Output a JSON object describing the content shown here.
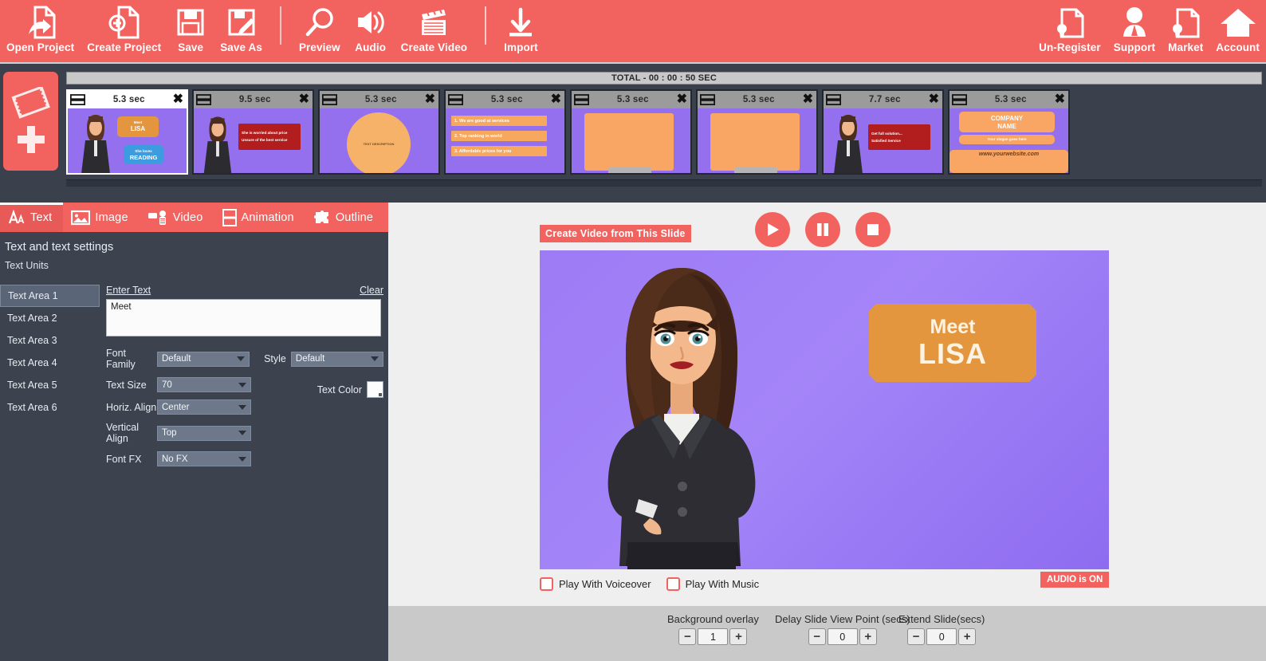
{
  "toolbar": {
    "left_items": [
      {
        "label": "Open Project",
        "icon": "open-project-icon"
      },
      {
        "label": "Create Project",
        "icon": "create-project-icon"
      },
      {
        "label": "Save",
        "icon": "save-icon"
      },
      {
        "label": "Save As",
        "icon": "save-as-icon"
      },
      {
        "label": "Preview",
        "icon": "preview-magnifier-icon"
      },
      {
        "label": "Audio",
        "icon": "audio-speaker-icon"
      },
      {
        "label": "Create Video",
        "icon": "create-video-clapper-icon"
      },
      {
        "label": "Import",
        "icon": "import-download-icon"
      }
    ],
    "right_items": [
      {
        "label": "Un-Register",
        "icon": "un-register-certificate-icon"
      },
      {
        "label": "Support",
        "icon": "support-person-icon"
      },
      {
        "label": "Market",
        "icon": "market-certificate-icon"
      },
      {
        "label": "Account",
        "icon": "account-home-icon"
      }
    ],
    "accent_color": "#f2635f"
  },
  "timeline": {
    "total_label": "TOTAL -  00 : 00 : 50 SEC",
    "add_slide_name": "add-slide-button",
    "slides": [
      {
        "duration": "5.3 sec",
        "active": true,
        "kind": "woman-meet-lisa",
        "texts": [
          "Meet",
          "LISA",
          "She loves",
          "READING"
        ]
      },
      {
        "duration": "9.5 sec",
        "active": false,
        "kind": "woman-red-box",
        "texts": [
          "She is worried about price",
          "Unsure of the best service"
        ]
      },
      {
        "duration": "5.3 sec",
        "active": false,
        "kind": "circle",
        "texts": [
          "TEXT DESCRIPTION"
        ]
      },
      {
        "duration": "5.3 sec",
        "active": false,
        "kind": "list",
        "texts": [
          "1. We are good at services",
          "2. Top ranking in world",
          "3. Affordable prices for you"
        ]
      },
      {
        "duration": "5.3 sec",
        "active": false,
        "kind": "orange-panel",
        "texts": []
      },
      {
        "duration": "5.3 sec",
        "active": false,
        "kind": "orange-panel",
        "texts": []
      },
      {
        "duration": "7.7 sec",
        "active": false,
        "kind": "woman-red-box",
        "texts": [
          "Get full solution...",
          "Satisfied Service"
        ]
      },
      {
        "duration": "5.3 sec",
        "active": false,
        "kind": "company",
        "texts": [
          "COMPANY",
          "NAME",
          "Your slogan goes here",
          "www.yourwebsite.com"
        ]
      }
    ]
  },
  "left_panel": {
    "tabs": [
      {
        "label": "Text",
        "icon": "text-aa-icon",
        "active": true
      },
      {
        "label": "Image",
        "icon": "image-picture-icon",
        "active": false
      },
      {
        "label": "Video",
        "icon": "video-camera-icon",
        "active": false
      },
      {
        "label": "Animation",
        "icon": "animation-frames-icon",
        "active": false
      },
      {
        "label": "Outline",
        "icon": "outline-puzzle-icon",
        "active": false
      }
    ],
    "title": "Text and text settings",
    "units_header": "Text Units",
    "units": [
      {
        "label": "Text Area 1",
        "selected": true
      },
      {
        "label": "Text Area 2",
        "selected": false
      },
      {
        "label": "Text Area 3",
        "selected": false
      },
      {
        "label": "Text Area 4",
        "selected": false
      },
      {
        "label": "Text Area 5",
        "selected": false
      },
      {
        "label": "Text Area 6",
        "selected": false
      }
    ],
    "enter_text_label": "Enter Text",
    "clear_label": "Clear",
    "text_value": "Meet",
    "fields": {
      "font_family_label": "Font Family",
      "font_family_value": "Default",
      "style_label": "Style",
      "style_value": "Default",
      "text_size_label": "Text Size",
      "text_size_value": "70",
      "horiz_align_label": "Horiz. Align",
      "horiz_align_value": "Center",
      "vertical_align_label": "Vertical Align",
      "vertical_align_value": "Top",
      "font_fx_label": "Font FX",
      "font_fx_value": "No FX",
      "text_color_label": "Text Color",
      "text_color_value": "#fdfdfd"
    }
  },
  "preview": {
    "create_video_button": "Create Video from This Slide",
    "play_name": "play-button",
    "pause_name": "pause-button",
    "stop_name": "stop-button",
    "slide": {
      "background_color": "#9d7bf5",
      "callout_color": "#e3963e",
      "callout_line1": "Meet",
      "callout_line2": "LISA",
      "character": "cartoon-businesswoman"
    },
    "checkboxes": [
      {
        "label": "Play With Voiceover",
        "checked": false
      },
      {
        "label": "Play With Music",
        "checked": false
      }
    ],
    "audio_badge": "AUDIO is ON"
  },
  "bottom_controls": [
    {
      "label": "Background overlay",
      "value": "1",
      "minus": "−",
      "plus": "+"
    },
    {
      "label": "Delay Slide View Point (secs)",
      "value": "0",
      "minus": "−",
      "plus": "+"
    },
    {
      "label": "Extend Slide(secs)",
      "value": "0",
      "minus": "−",
      "plus": "+"
    }
  ]
}
